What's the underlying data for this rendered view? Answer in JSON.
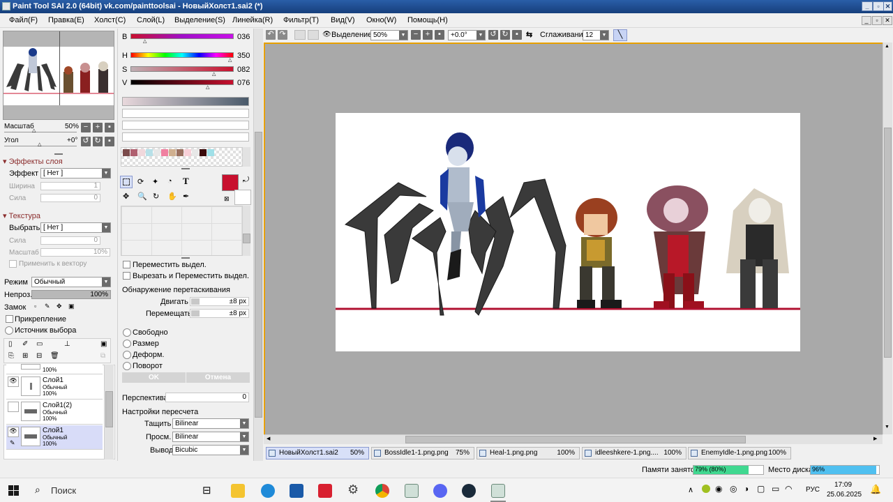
{
  "window": {
    "title": "Paint Tool SAI 2.0 (64bit) vk.com/painttoolsai - НовыйХолст1.sai2 (*)",
    "minimize": "_",
    "restore": "▫",
    "close": "✕"
  },
  "menu": [
    "Файл(F)",
    "Правка(E)",
    "Холст(C)",
    "Слой(L)",
    "Выделение(S)",
    "Линейка(R)",
    "Фильтр(T)",
    "Вид(V)",
    "Окно(W)",
    "Помощь(H)"
  ],
  "navigator": {
    "zoom_label": "Масштаб",
    "zoom_value": "50%",
    "angle_label": "Угол",
    "angle_value": "+0°"
  },
  "layer_effects": {
    "section": "Эффекты слоя",
    "effect_label": "Эффект",
    "effect_value": "[ Нет ]",
    "width_label": "Ширина",
    "width_value": "1",
    "strength_label": "Сила",
    "strength_value": "0"
  },
  "texture": {
    "section": "Текстура",
    "select_label": "Выбрать",
    "select_value": "[ Нет ]",
    "strength_label": "Сила",
    "strength_value": "0",
    "scale_label": "Масштаб",
    "scale_value": "10%",
    "apply_vector": "Применить к вектору"
  },
  "blend": {
    "mode_label": "Режим",
    "mode_value": "Обычный",
    "opacity_label": "Непроз.",
    "opacity_value": "100%",
    "lock_label": "Замок",
    "clip_label": "Прикрепление",
    "source_label": "Источник выбора"
  },
  "layers": [
    {
      "name": "",
      "mode": "",
      "opacity": "100%",
      "visible": false,
      "selected": false
    },
    {
      "name": "Слой1",
      "mode": "Обычный",
      "opacity": "100%",
      "visible": true,
      "selected": false
    },
    {
      "name": "Слой1(2)",
      "mode": "Обычный",
      "opacity": "100%",
      "visible": false,
      "selected": false
    },
    {
      "name": "Слой1",
      "mode": "Обычный",
      "opacity": "100%",
      "visible": true,
      "selected": true
    }
  ],
  "color": {
    "b_label": "B",
    "b_value": "036",
    "h_label": "H",
    "h_value": "350",
    "s_label": "S",
    "s_value": "082",
    "v_label": "V",
    "v_value": "076",
    "primary": "#c8102e"
  },
  "swatches": [
    "#7a4a4a",
    "#b06070",
    "#f0d8dc",
    "#b8e0e8",
    "#e8e8e8",
    "#f080a0",
    "#d0b090",
    "#9a7060",
    "#f8d0d8",
    "#e8e8e8",
    "#3a0a0a",
    "#a0e0e8"
  ],
  "tool_options": {
    "move_selection": "Переместить выдел.",
    "cut_move_selection": "Вырезать и Переместить выдел.",
    "drag_detect": "Обнаружение перетаскивания",
    "move_label": "Двигать",
    "move_value": "±8 px",
    "shift_label": "Перемещать",
    "shift_value": "±8 px",
    "free": "Свободно",
    "size": "Размер",
    "deform": "Деформ.",
    "rotate": "Поворот",
    "ok": "OK",
    "cancel": "Отмена",
    "perspective_label": "Перспектива",
    "perspective_value": "0",
    "resample_title": "Настройки пересчета",
    "drag_label": "Тащить",
    "drag_value": "Bilinear",
    "preview_label": "Просм.",
    "preview_value": "Bilinear",
    "output_label": "Вывод",
    "output_value": "Bicubic"
  },
  "canvas_toolbar": {
    "selection_label": "Выделение",
    "zoom_value": "50%",
    "angle_value": "+0.0°",
    "stabilizer_label": "Сглаживание",
    "stabilizer_value": "12"
  },
  "tabs": [
    {
      "name": "НовыйХолст1.sai2",
      "pct": "50%",
      "active": true
    },
    {
      "name": "BossIdle1-1.png.png",
      "pct": "75%",
      "active": false
    },
    {
      "name": "Heal-1.png.png",
      "pct": "100%",
      "active": false
    },
    {
      "name": "idleeshkere-1.png....",
      "pct": "100%",
      "active": false
    },
    {
      "name": "EnemyIdle-1.png.png",
      "pct": "100%",
      "active": false
    }
  ],
  "status": {
    "memory_label": "Памяти занято",
    "memory_value": "79% (80%)",
    "memory_fraction": 0.79,
    "disk_label": "Место диска",
    "disk_value": "96%",
    "disk_fraction": 0.96
  },
  "taskbar": {
    "search": "Поиск",
    "lang": "РУС",
    "time": "17:09",
    "date": "25.06.2025"
  }
}
